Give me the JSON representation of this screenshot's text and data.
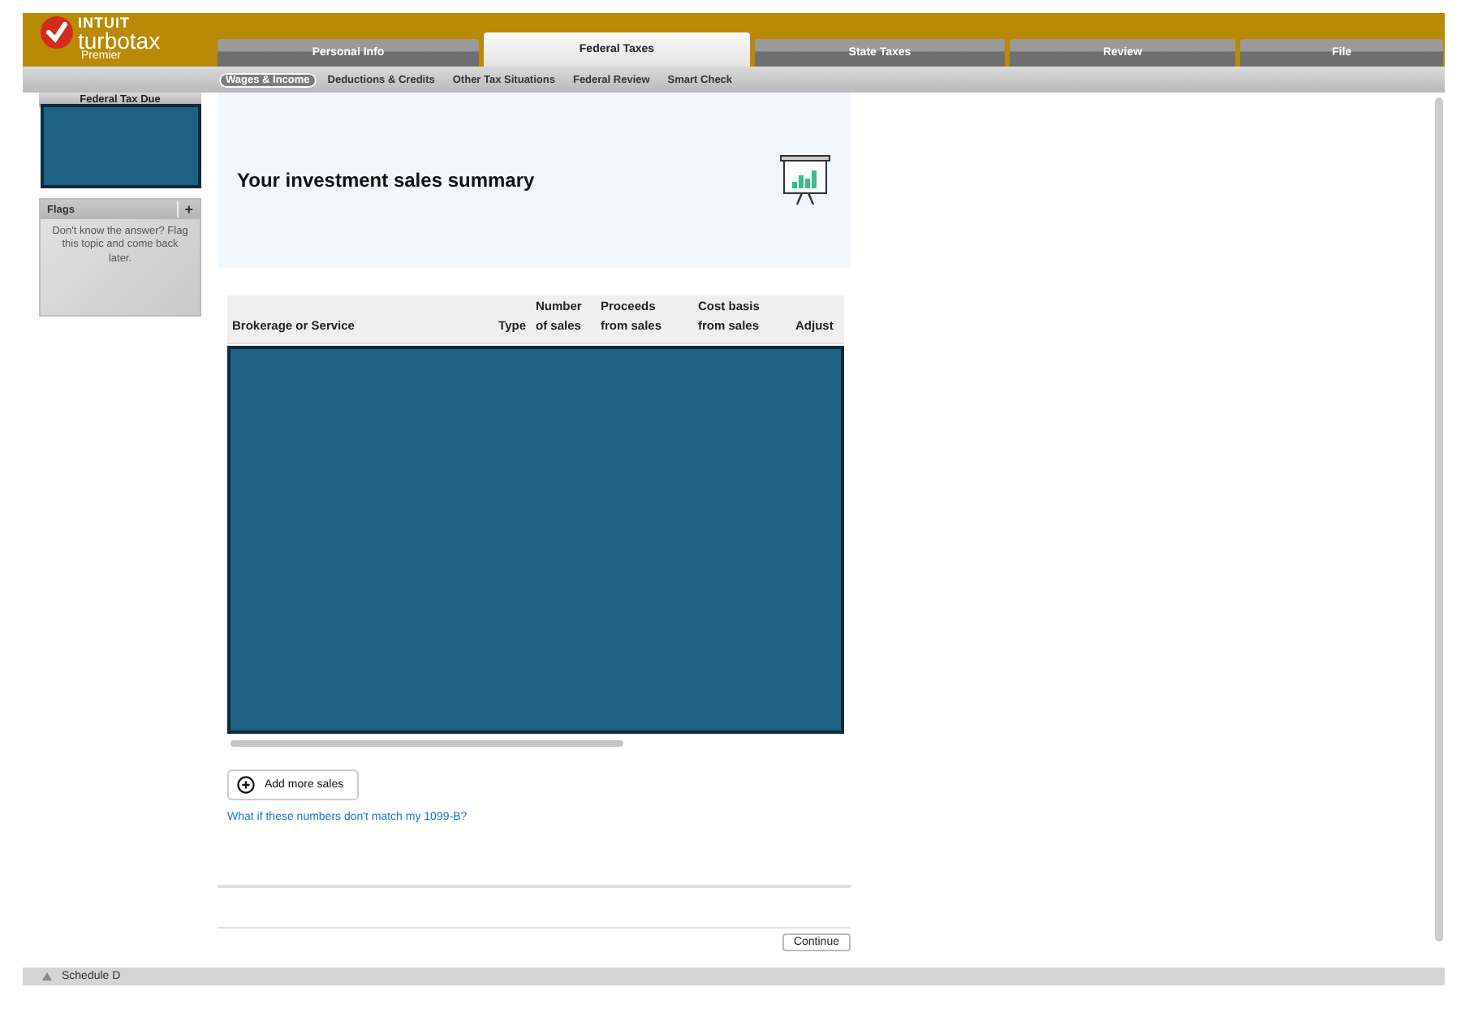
{
  "brand": {
    "company": "INTUIT",
    "product": "turbotax",
    "edition": "Premier"
  },
  "tabs": [
    {
      "label": "Personal Info",
      "selected": false
    },
    {
      "label": "Federal Taxes",
      "selected": true
    },
    {
      "label": "State Taxes",
      "selected": false
    },
    {
      "label": "Review",
      "selected": false
    },
    {
      "label": "File",
      "selected": false
    }
  ],
  "subnav": [
    {
      "label": "Wages & Income",
      "selected": true
    },
    {
      "label": "Deductions & Credits",
      "selected": false
    },
    {
      "label": "Other Tax Situations",
      "selected": false
    },
    {
      "label": "Federal Review",
      "selected": false
    },
    {
      "label": "Smart Check",
      "selected": false
    }
  ],
  "sidebar": {
    "tax_due": {
      "label": "Federal Tax Due",
      "redacted": true
    },
    "flags": {
      "title": "Flags",
      "add": "+",
      "hint": "Don't know the answer? Flag this topic and come back later."
    }
  },
  "page": {
    "title": "Your investment sales summary",
    "table": {
      "columns": [
        "Brokerage or Service",
        "Type",
        "Number\nof sales",
        "Proceeds\nfrom sales",
        "Cost basis\nfrom sales",
        "Adjust"
      ],
      "redacted": true
    },
    "add_button": "Add more sales",
    "help_link": "What if these numbers don't match my 1099-B?",
    "continue_button": "Continue"
  },
  "status_bar": {
    "label": "Schedule D"
  }
}
